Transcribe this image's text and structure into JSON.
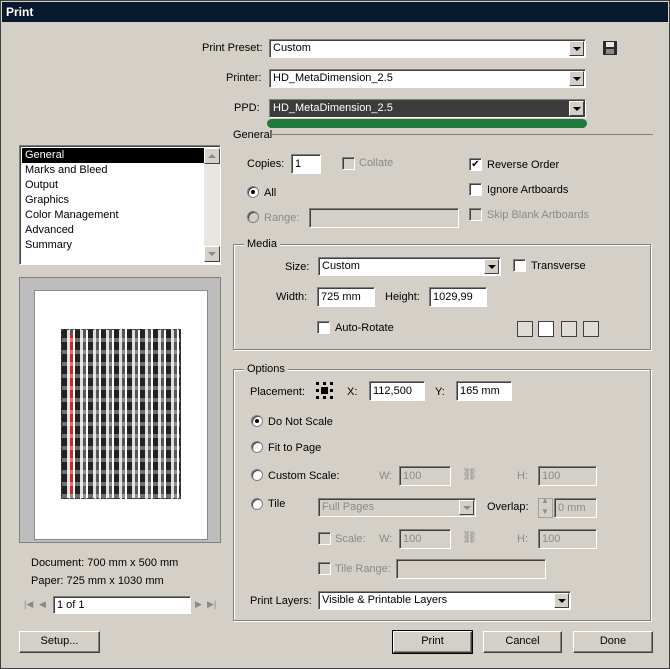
{
  "window": {
    "title": "Print"
  },
  "preset": {
    "label": "Print Preset:",
    "value": "Custom"
  },
  "printer": {
    "label": "Printer:",
    "value": "HD_MetaDimension_2.5"
  },
  "ppd": {
    "label": "PPD:",
    "value": "HD_MetaDimension_2.5",
    "highlight_color": "#1e7a3c"
  },
  "section_title": "General",
  "sidebar": {
    "items": [
      {
        "label": "General",
        "selected": true
      },
      {
        "label": "Marks and Bleed"
      },
      {
        "label": "Output"
      },
      {
        "label": "Graphics"
      },
      {
        "label": "Color Management"
      },
      {
        "label": "Advanced"
      },
      {
        "label": "Summary"
      }
    ]
  },
  "preview": {
    "document_info": "Document: 700 mm x 500 mm",
    "paper_info": "Paper: 725 mm x 1030 mm",
    "page_field": "1 of 1"
  },
  "general": {
    "copies_label": "Copies:",
    "copies_value": "1",
    "collate_label": "Collate",
    "reverse_order_label": "Reverse Order",
    "reverse_order_checked": true,
    "ignore_artboards_label": "Ignore Artboards",
    "skip_blank_label": "Skip Blank Artboards",
    "all_label": "All",
    "range_label": "Range:"
  },
  "media": {
    "title": "Media",
    "size_label": "Size:",
    "size_value": "Custom",
    "transverse_label": "Transverse",
    "width_label": "Width:",
    "width_value": "725 mm",
    "height_label": "Height:",
    "height_value": "1029,99",
    "auto_rotate_label": "Auto-Rotate"
  },
  "options": {
    "title": "Options",
    "placement_label": "Placement:",
    "x_label": "X:",
    "x_value": "112,500",
    "y_label": "Y:",
    "y_value": "165 mm",
    "do_not_scale_label": "Do Not Scale",
    "fit_to_page_label": "Fit to Page",
    "custom_scale_label": "Custom Scale:",
    "w_label": "W:",
    "w_value": "100",
    "h_label": "H:",
    "h_value": "100",
    "tile_label": "Tile",
    "tile_select_value": "Full Pages",
    "overlap_label": "Overlap:",
    "overlap_value": "0 mm",
    "scale_label": "Scale:",
    "scale_w_label": "W:",
    "scale_w_value": "100",
    "scale_h_label": "H:",
    "scale_h_value": "100",
    "tile_range_label": "Tile Range:",
    "print_layers_label": "Print Layers:",
    "print_layers_value": "Visible & Printable Layers"
  },
  "buttons": {
    "setup": "Setup...",
    "print": "Print",
    "cancel": "Cancel",
    "done": "Done"
  }
}
